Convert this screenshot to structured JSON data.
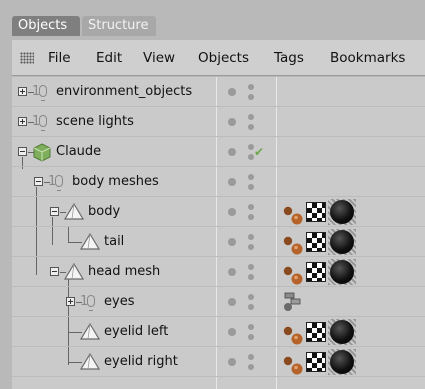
{
  "tabs": [
    {
      "label": "Objects",
      "active": true
    },
    {
      "label": "Structure",
      "active": false
    }
  ],
  "menu": [
    "File",
    "Edit",
    "View",
    "Objects",
    "Tags",
    "Bookmarks"
  ],
  "rows": [
    {
      "label": "environment_objects",
      "icon": "null-icon",
      "expander": "plus",
      "tags": []
    },
    {
      "label": "scene lights",
      "icon": "null-icon",
      "expander": "plus",
      "tags": []
    },
    {
      "label": "Claude",
      "icon": "cube-object-icon",
      "expander": "minus",
      "checked": true,
      "tags": []
    },
    {
      "label": "body meshes",
      "icon": "null-icon",
      "expander": "minus",
      "tags": []
    },
    {
      "label": "body",
      "icon": "polygon-object-icon",
      "expander": "minus",
      "tags": [
        "phong-tag-icon",
        "texture-tag-icon",
        "material-tag-icon"
      ]
    },
    {
      "label": "tail",
      "icon": "polygon-object-icon",
      "expander": "none",
      "tags": [
        "phong-tag-icon",
        "texture-tag-icon",
        "material-tag-icon"
      ]
    },
    {
      "label": "head mesh",
      "icon": "polygon-object-icon",
      "expander": "minus",
      "tags": [
        "phong-tag-icon",
        "texture-tag-icon",
        "material-tag-icon"
      ]
    },
    {
      "label": "eyes",
      "icon": "null-icon",
      "expander": "plus",
      "tags": [
        "hierarchy-tag-icon"
      ]
    },
    {
      "label": "eyelid left",
      "icon": "polygon-object-icon",
      "expander": "none",
      "tags": [
        "phong-tag-icon",
        "texture-tag-icon",
        "material-tag-icon"
      ]
    },
    {
      "label": "eyelid right",
      "icon": "polygon-object-icon",
      "expander": "none",
      "tags": [
        "phong-tag-icon",
        "texture-tag-icon",
        "material-tag-icon"
      ]
    }
  ],
  "colors": {
    "panel_bg": "#cacaca",
    "tab_active": "#7f7f7f",
    "check_green": "#6aa84f"
  }
}
